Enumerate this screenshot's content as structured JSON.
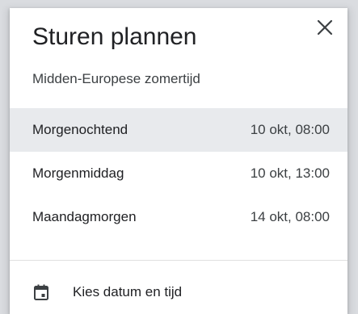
{
  "dialog": {
    "title": "Sturen plannen",
    "close_icon": "close-icon",
    "timezone": "Midden-Europese zomertijd"
  },
  "options": [
    {
      "label": "Morgenochtend",
      "time": "10 okt, 08:00",
      "selected": true
    },
    {
      "label": "Morgenmiddag",
      "time": "10 okt, 13:00",
      "selected": false
    },
    {
      "label": "Maandagmorgen",
      "time": "14 okt, 08:00",
      "selected": false
    }
  ],
  "pick_custom": {
    "icon": "calendar-icon",
    "label": "Kies datum en tijd"
  },
  "colors": {
    "selected_row": "#e8eaed",
    "backdrop": "#dadce0",
    "text": "#202124"
  }
}
